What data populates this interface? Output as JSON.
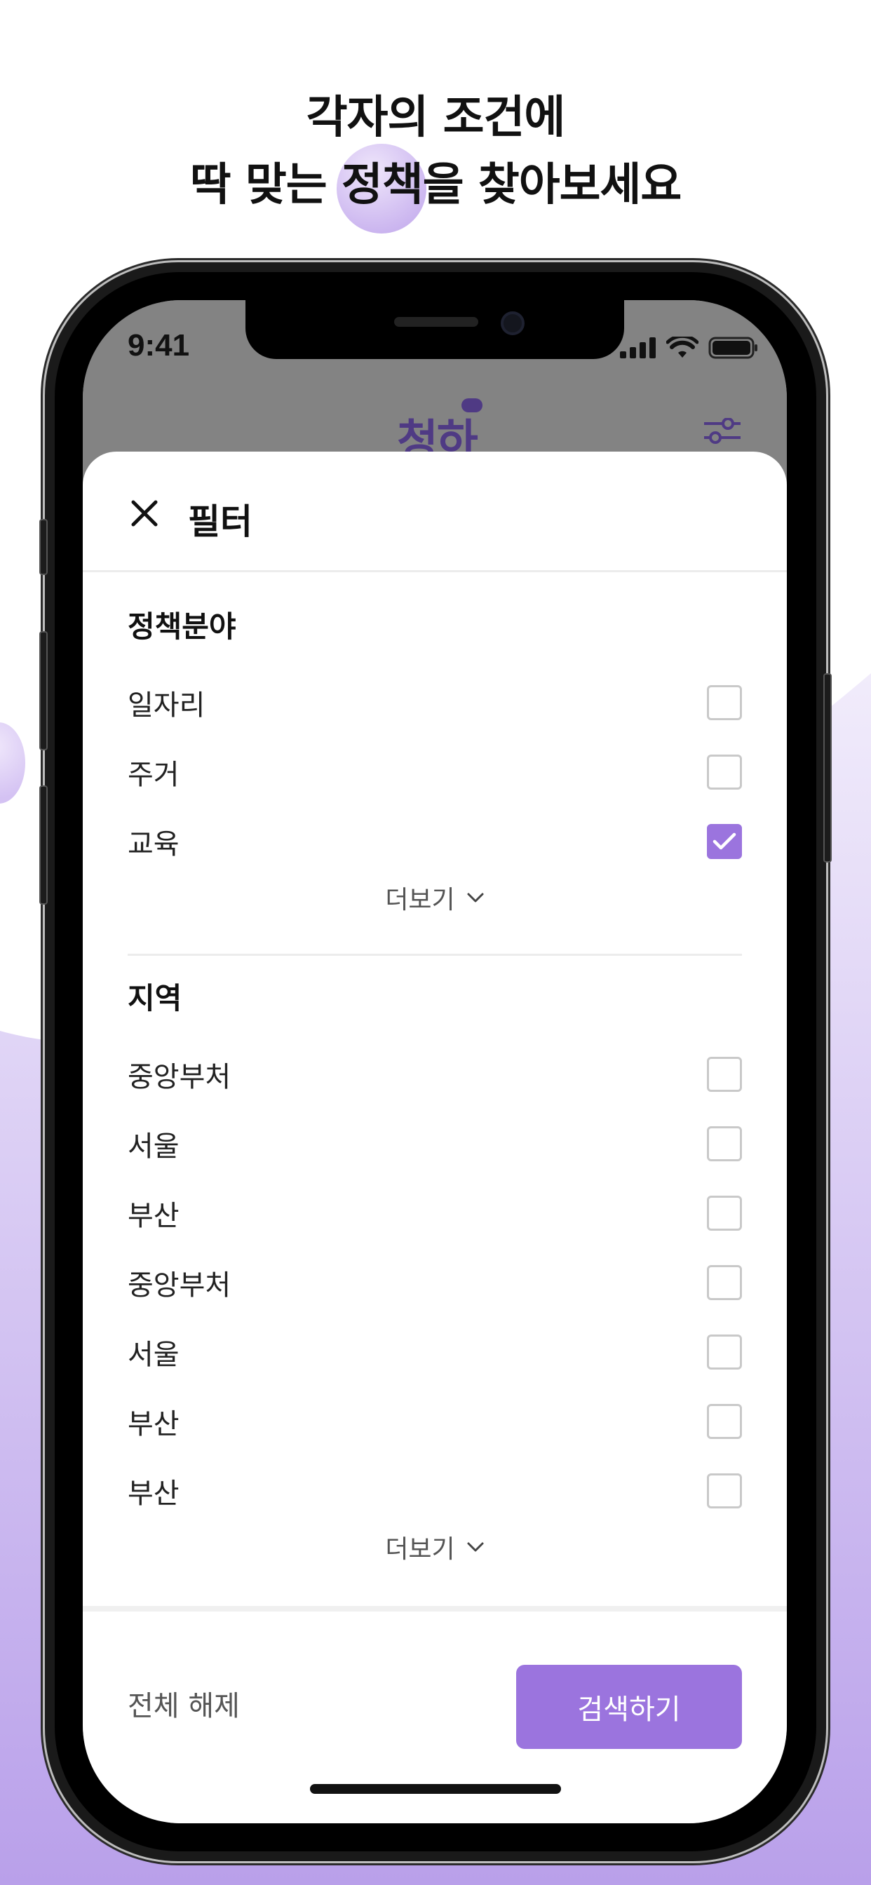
{
  "headline": {
    "line1": "각자의 조건에",
    "line2": "딱 맞는 정책을 찾아보세요"
  },
  "status_bar": {
    "time": "9:41"
  },
  "app": {
    "logo": "청하"
  },
  "sheet": {
    "title": "필터",
    "sections": [
      {
        "title": "정책분야",
        "items": [
          {
            "label": "일자리",
            "checked": false
          },
          {
            "label": "주거",
            "checked": false
          },
          {
            "label": "교육",
            "checked": true
          }
        ],
        "more_label": "더보기"
      },
      {
        "title": "지역",
        "items": [
          {
            "label": "중앙부처",
            "checked": false
          },
          {
            "label": "서울",
            "checked": false
          },
          {
            "label": "부산",
            "checked": false
          },
          {
            "label": "중앙부처",
            "checked": false
          },
          {
            "label": "서울",
            "checked": false
          },
          {
            "label": "부산",
            "checked": false
          },
          {
            "label": "부산",
            "checked": false
          }
        ],
        "more_label": "더보기"
      }
    ],
    "footer": {
      "reset_label": "전체 해제",
      "search_label": "검색하기"
    }
  },
  "colors": {
    "accent": "#9b74de",
    "background_gradient_end": "#b79fe8"
  }
}
